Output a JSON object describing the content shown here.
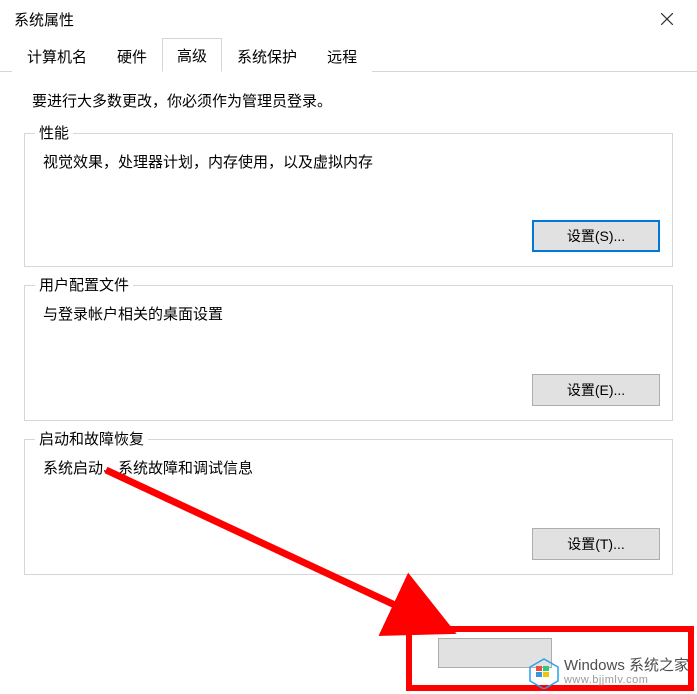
{
  "window": {
    "title": "系统属性"
  },
  "tabs": {
    "items": [
      {
        "label": "计算机名"
      },
      {
        "label": "硬件"
      },
      {
        "label": "高级"
      },
      {
        "label": "系统保护"
      },
      {
        "label": "远程"
      }
    ],
    "active_index": 2
  },
  "instruction": "要进行大多数更改，你必须作为管理员登录。",
  "groups": {
    "performance": {
      "title": "性能",
      "desc": "视觉效果，处理器计划，内存使用，以及虚拟内存",
      "button": "设置(S)..."
    },
    "userprofile": {
      "title": "用户配置文件",
      "desc": "与登录帐户相关的桌面设置",
      "button": "设置(E)..."
    },
    "startup": {
      "title": "启动和故障恢复",
      "desc": "系统启动、系统故障和调试信息",
      "button": "设置(T)..."
    }
  },
  "watermark": {
    "line1": "Windows 系统之家",
    "line2": "www.bjjmlv.com"
  }
}
